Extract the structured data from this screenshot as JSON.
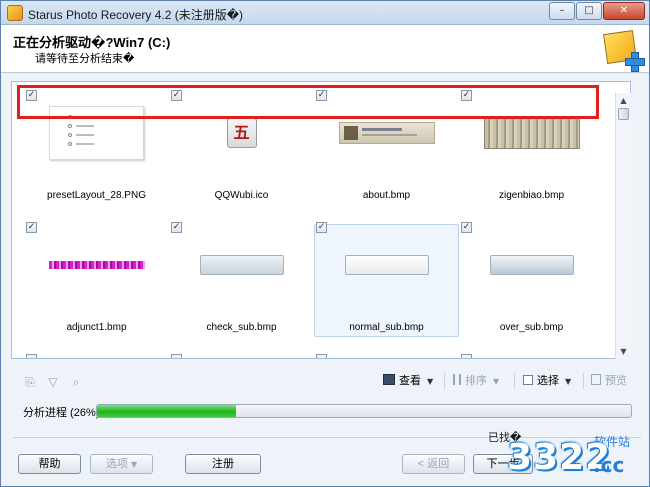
{
  "window": {
    "title": "Starus Photo Recovery 4.2 (未注册版�)",
    "controls": {
      "minimize": "–",
      "maximize": "□",
      "close": "✕"
    }
  },
  "header": {
    "title": "正在分析驱动�?Win7 (C:)",
    "subtitle": "请等待至分析结束�"
  },
  "files": [
    {
      "name": "presetLayout_28.PNG",
      "thumb": "doc",
      "checked": true
    },
    {
      "name": "QQWubi.ico",
      "thumb": "ico",
      "checked": true,
      "glyph": "五"
    },
    {
      "name": "about.bmp",
      "thumb": "about",
      "checked": true
    },
    {
      "name": "zigenbiao.bmp",
      "thumb": "zigen",
      "checked": true
    },
    {
      "name": "adjunct1.bmp",
      "thumb": "adj",
      "checked": true
    },
    {
      "name": "check_sub.bmp",
      "thumb": "check",
      "checked": true
    },
    {
      "name": "normal_sub.bmp",
      "thumb": "normal",
      "checked": true,
      "selected": true
    },
    {
      "name": "over_sub.bmp",
      "thumb": "over",
      "checked": true
    }
  ],
  "toolbar": {
    "view_label": "查看",
    "sort_label": "排序",
    "select_label": "选择",
    "preview_label": "预览"
  },
  "progress": {
    "label": "分析进程 (26%)",
    "percent": 26
  },
  "status": {
    "text": "已找�"
  },
  "buttons": {
    "help": "帮助",
    "options": "选项",
    "register": "注册",
    "back": "< 返回",
    "next": "下一步"
  },
  "watermark": {
    "number": "3322",
    "suffix": ".cc",
    "site": "软件站"
  },
  "colors": {
    "highlight_box": "#e0201d",
    "progress_fill": "#1fb31f",
    "window_bg": "#eef3f9"
  }
}
